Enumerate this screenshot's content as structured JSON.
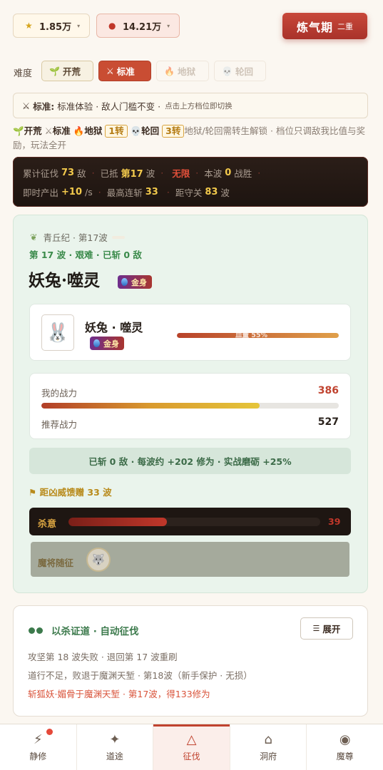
{
  "currency": {
    "star_icon": "star-icon",
    "star_value": "1.85万",
    "blood_icon": "blood-drop-icon",
    "blood_value": "14.21万",
    "caret": "▾"
  },
  "realm": {
    "main": "炼气期",
    "sub": "二重"
  },
  "difficulty": {
    "label": "难度",
    "options": [
      {
        "icon": "🌱",
        "label": "开荒"
      },
      {
        "icon": "⚔",
        "label": "标准"
      },
      {
        "icon": "🔥",
        "label": "地狱"
      },
      {
        "icon": "💀",
        "label": "轮回"
      }
    ],
    "selected": "标准"
  },
  "info_bar": {
    "icon": "⚔",
    "name": "标准:",
    "desc": "标准体验 · 敌人门槛不变 ·",
    "hint": "点击上方档位即切换"
  },
  "unlock": {
    "i1": "🌱",
    "t1": "开荒",
    "i2": "⚔",
    "t2": "标准",
    "i3": "🔥",
    "t3": "地狱",
    "tag1": "1转",
    "i4": "💀",
    "t4": "轮回",
    "tag2": "3转",
    "rest": "地狱/轮回需转生解锁 · 档位只调敌我比值与奖励，玩法全开"
  },
  "stats": {
    "total_label": "累计征伐",
    "total_val": "73",
    "total_unit": "敌",
    "reached_label": "已抵",
    "reached_val": "第17",
    "reached_unit": "波",
    "unlimited": "无限",
    "wave_label": "本波",
    "wave_val": "0",
    "wave_unit": "战胜",
    "rate_label": "即时产出",
    "rate_val": "+10",
    "rate_unit": "/s",
    "streak_label": "最高连斩",
    "streak_val": "33",
    "dist_label": "距守关",
    "dist_val": "83",
    "dist_unit": "波"
  },
  "battle": {
    "crumb_icon": "leaf-icon",
    "crumb": "青丘纪 · 第17波",
    "wave_line": "第 17 波 · 艰难 · 已斩 0 敌",
    "enemy_title": "妖兔·噬灵",
    "badge": "金身",
    "enemy_name": "妖兔 · 噬灵",
    "enemy_badge": "金身",
    "hp_text": "血量 55%",
    "hp_percent": 100,
    "my_power_label": "我的战力",
    "my_power": "386",
    "rec_power_label": "推荐战力",
    "rec_power": "527",
    "power_ratio": 0.733,
    "gain_text": "已斩 0 敌 · 每波约 +202 修为 · 实战磨砺 +25%",
    "boss_flag": "⚑",
    "boss_text": "距凶威馈赠 33 波",
    "kill_label": "杀意",
    "kill_value": "39",
    "kill_ratio": 0.39,
    "follow_label": "魔将随征"
  },
  "log": {
    "title": "以杀证道 · 自动征伐",
    "expand": "展开",
    "lines": [
      "攻坚第 18 波失败 · 退回第 17 波重刷",
      "道行不足，败退于魔渊天堑 · 第18波（新手保护 · 无损）",
      "斩狐妖·媚骨于魔渊天堑 · 第17波，得133修为"
    ]
  },
  "nav": [
    {
      "icon": "⚡",
      "label": "静修"
    },
    {
      "icon": "✦",
      "label": "道途"
    },
    {
      "icon": "△",
      "label": "征伐"
    },
    {
      "icon": "⌂",
      "label": "洞府"
    },
    {
      "icon": "◉",
      "label": "魔尊"
    }
  ],
  "colors": {
    "accent": "#c0432f",
    "green": "#3c7a4c",
    "gold": "#f2c94c"
  }
}
